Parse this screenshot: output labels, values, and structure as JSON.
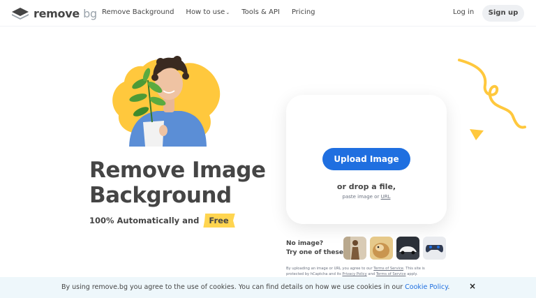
{
  "nav": {
    "logo_bold": "remove",
    "logo_light": "bg",
    "links": [
      {
        "label": "Remove Background"
      },
      {
        "label": "How to use",
        "has_dropdown": true
      },
      {
        "label": "Tools & API"
      },
      {
        "label": "Pricing"
      }
    ],
    "login": "Log in",
    "signup": "Sign up"
  },
  "hero": {
    "title_line1": "Remove Image",
    "title_line2": "Background",
    "subtitle": "100% Automatically and",
    "badge": "Free"
  },
  "upload": {
    "button": "Upload Image",
    "drop_text": "or drop a file,",
    "paste_prefix": "paste image or",
    "url_link": "URL"
  },
  "samples": {
    "line1": "No image?",
    "line2": "Try one of these:",
    "thumbnails": [
      "woman-photo",
      "dog-photo",
      "car-photo",
      "gamepad-photo"
    ]
  },
  "legal": {
    "part1": "By uploading an image or URL you agree to our",
    "tos1": "Terms of Service",
    "part2": ". This site is protected by hCaptcha and its",
    "privacy": "Privacy Policy",
    "part3": "and",
    "tos2": "Terms of Service",
    "part4": "apply."
  },
  "cookie": {
    "text": "By using remove.bg you agree to the use of cookies. You can find details on how we use cookies in our",
    "link": "Cookie Policy",
    "end": ".",
    "close": "×"
  },
  "colors": {
    "accent_blue": "#1f6fe0",
    "yellow": "#ffd550",
    "text": "#454545",
    "cookie_bg": "#eef7fb"
  }
}
